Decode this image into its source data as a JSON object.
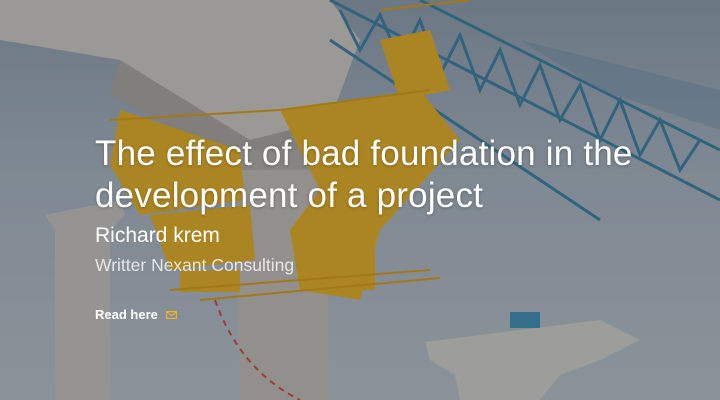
{
  "article": {
    "title": "The effect of bad foundation in the development of a project",
    "author": "Richard krem",
    "role": "Writter Nexant Consulting",
    "cta_label": "Read here"
  },
  "colors": {
    "sky": "#a9b4bd",
    "concrete": "#c9c6bf",
    "steel_yellow": "#e6ad22",
    "gantry_blue": "#3c7fa0",
    "cta_icon": "#f1b32a"
  },
  "icons": {
    "cta": "mail-icon"
  }
}
